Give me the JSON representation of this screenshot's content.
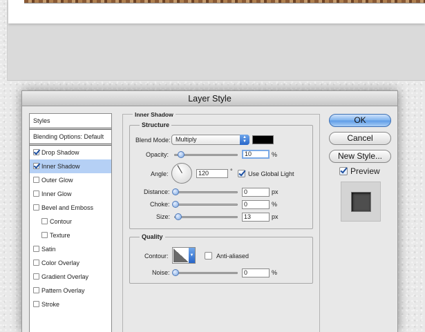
{
  "dialog": {
    "title": "Layer Style"
  },
  "styles_list": {
    "header": "Styles",
    "blending": "Blending Options: Default",
    "items": [
      {
        "label": "Drop Shadow",
        "checked": true,
        "selected": false,
        "indent": false
      },
      {
        "label": "Inner Shadow",
        "checked": true,
        "selected": true,
        "indent": false
      },
      {
        "label": "Outer Glow",
        "checked": false,
        "selected": false,
        "indent": false
      },
      {
        "label": "Inner Glow",
        "checked": false,
        "selected": false,
        "indent": false
      },
      {
        "label": "Bevel and Emboss",
        "checked": false,
        "selected": false,
        "indent": false
      },
      {
        "label": "Contour",
        "checked": false,
        "selected": false,
        "indent": true
      },
      {
        "label": "Texture",
        "checked": false,
        "selected": false,
        "indent": true
      },
      {
        "label": "Satin",
        "checked": false,
        "selected": false,
        "indent": false
      },
      {
        "label": "Color Overlay",
        "checked": false,
        "selected": false,
        "indent": false
      },
      {
        "label": "Gradient Overlay",
        "checked": false,
        "selected": false,
        "indent": false
      },
      {
        "label": "Pattern Overlay",
        "checked": false,
        "selected": false,
        "indent": false
      },
      {
        "label": "Stroke",
        "checked": false,
        "selected": false,
        "indent": false
      }
    ]
  },
  "inner_shadow": {
    "title": "Inner Shadow",
    "structure": {
      "title": "Structure",
      "blend_mode_label": "Blend Mode:",
      "blend_mode_value": "Multiply",
      "color": "#000000",
      "opacity_label": "Opacity:",
      "opacity_value": "10",
      "opacity_unit": "%",
      "opacity_fraction": 0.1,
      "angle_label": "Angle:",
      "angle_value": "120",
      "angle_unit": "°",
      "use_global_light_label": "Use Global Light",
      "use_global_light": true,
      "distance_label": "Distance:",
      "distance_value": "0",
      "distance_unit": "px",
      "distance_fraction": 0.0,
      "choke_label": "Choke:",
      "choke_value": "0",
      "choke_unit": "%",
      "choke_fraction": 0.0,
      "size_label": "Size:",
      "size_value": "13",
      "size_unit": "px",
      "size_fraction": 0.052
    },
    "quality": {
      "title": "Quality",
      "contour_label": "Contour:",
      "anti_aliased_label": "Anti-aliased",
      "anti_aliased": false,
      "noise_label": "Noise:",
      "noise_value": "0",
      "noise_unit": "%",
      "noise_fraction": 0.0
    }
  },
  "buttons": {
    "ok": "OK",
    "cancel": "Cancel",
    "new_style": "New Style...",
    "preview_label": "Preview",
    "preview_checked": true
  },
  "colors": {
    "selection": "#b5d0f5",
    "accent": "#2866c9"
  }
}
